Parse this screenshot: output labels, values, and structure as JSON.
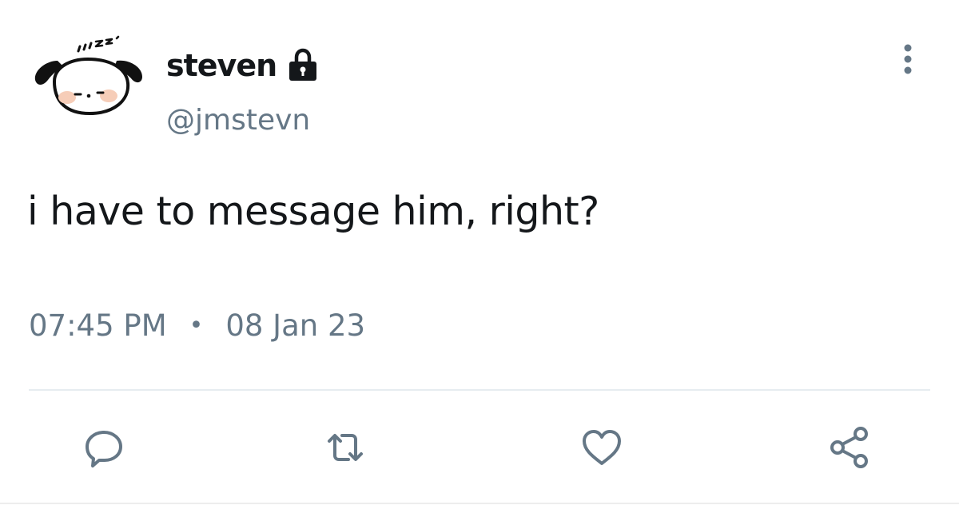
{
  "author": {
    "display_name": "steven",
    "handle": "@jmstevn",
    "protected": true,
    "avatar": "sleeping-dog-avatar",
    "lock_icon": "lock-icon"
  },
  "tweet": {
    "text": "i have to message him, right?",
    "time": "07:45 PM",
    "separator": "•",
    "date": "08 Jan 23"
  },
  "actions": [
    {
      "name": "reply",
      "icon": "speech-bubble-icon"
    },
    {
      "name": "retweet",
      "icon": "retweet-icon"
    },
    {
      "name": "like",
      "icon": "heart-icon"
    },
    {
      "name": "share",
      "icon": "share-icon"
    }
  ],
  "menu": {
    "icon": "vertical-ellipsis-icon"
  },
  "colors": {
    "text": "#14171a",
    "secondary": "#657786",
    "divider": "#e6ecf0"
  }
}
